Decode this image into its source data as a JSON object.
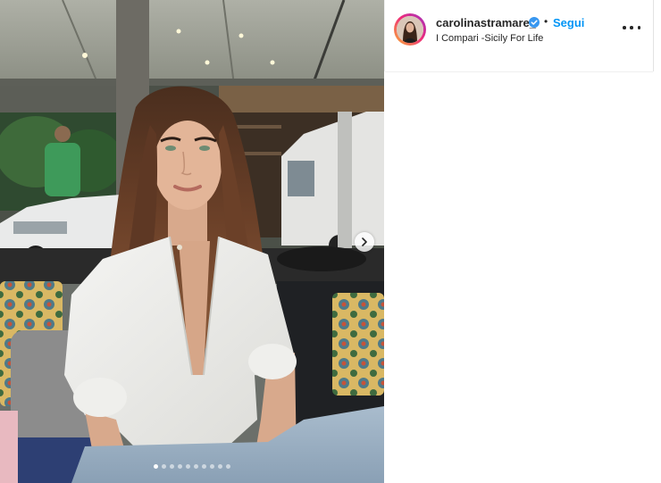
{
  "post": {
    "username": "carolinastramare_",
    "separator": "•",
    "follow_label": "Segui",
    "location": "I Compari -Sicily For Life",
    "verified_icon": "verified-badge-icon",
    "more_icon": "more-options-icon",
    "next_icon": "chevron-right-icon",
    "carousel": {
      "slide_count": 10,
      "current": 1
    },
    "colors": {
      "follow": "#0095f6",
      "verified": "#3897f0",
      "text": "#262626"
    }
  }
}
